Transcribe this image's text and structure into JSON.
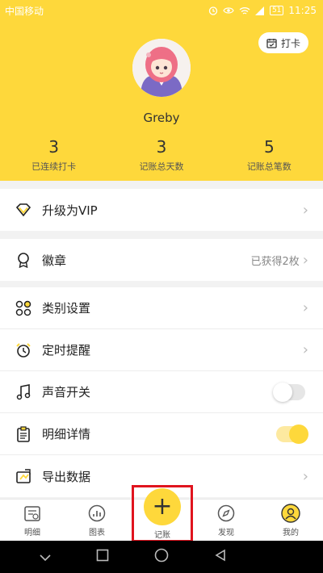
{
  "status_bar": {
    "carrier": "中国移动",
    "battery": "51",
    "time": "11:25"
  },
  "header": {
    "checkin_label": "打卡",
    "username": "Greby",
    "stats": [
      {
        "value": "3",
        "label": "已连续打卡"
      },
      {
        "value": "3",
        "label": "记账总天数"
      },
      {
        "value": "5",
        "label": "记账总笔数"
      }
    ]
  },
  "menu": {
    "vip": {
      "label": "升级为VIP",
      "icon": "diamond-icon"
    },
    "badge": {
      "label": "徽章",
      "value": "已获得2枚",
      "icon": "medal-icon"
    },
    "category": {
      "label": "类别设置",
      "icon": "grid-icon"
    },
    "reminder": {
      "label": "定时提醒",
      "icon": "alarm-icon"
    },
    "sound": {
      "label": "声音开关",
      "icon": "music-note-icon",
      "enabled": false
    },
    "detail": {
      "label": "明细详情",
      "icon": "clipboard-icon",
      "enabled": true
    },
    "export": {
      "label": "导出数据",
      "icon": "export-icon"
    }
  },
  "tabbar": {
    "tabs": [
      {
        "label": "明细",
        "icon": "ledger-icon"
      },
      {
        "label": "图表",
        "icon": "chart-icon"
      },
      {
        "label": "记账",
        "icon": "plus-icon"
      },
      {
        "label": "发现",
        "icon": "compass-icon"
      },
      {
        "label": "我的",
        "icon": "user-icon"
      }
    ]
  },
  "colors": {
    "accent": "#fed83b",
    "highlight_border": "#e0141e"
  }
}
